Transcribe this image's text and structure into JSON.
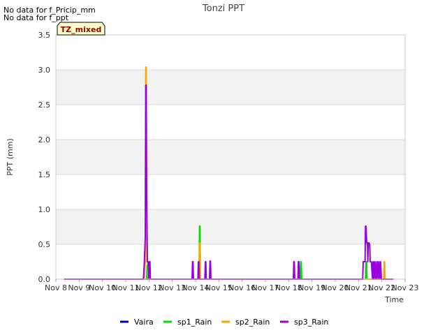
{
  "notes": [
    "No data for f_Pricip_mm",
    "No data for f_ppt"
  ],
  "badge": {
    "label": "TZ_mixed"
  },
  "chart_data": {
    "type": "line",
    "title": "Tonzi PPT",
    "xlabel": "Time",
    "ylabel": "PPT (mm)",
    "xlim": [
      8,
      23
    ],
    "ylim": [
      0,
      3.5
    ],
    "x_ticks": [
      8,
      9,
      10,
      11,
      12,
      13,
      14,
      15,
      16,
      17,
      18,
      19,
      20,
      21,
      22,
      23
    ],
    "x_tick_labels": [
      "Nov 8",
      "Nov 9",
      "Nov 10",
      "Nov 11",
      "Nov 12",
      "Nov 13",
      "Nov 14",
      "Nov 15",
      "Nov 16",
      "Nov 17",
      "Nov 18",
      "Nov 19",
      "Nov 20",
      "Nov 21",
      "Nov 22",
      "Nov 23"
    ],
    "y_ticks": [
      0.0,
      0.5,
      1.0,
      1.5,
      2.0,
      2.5,
      3.0,
      3.5
    ],
    "y_tick_labels": [
      "0.0",
      "0.5",
      "1.0",
      "1.5",
      "2.0",
      "2.5",
      "3.0",
      "3.5"
    ],
    "legend_position": "bottom",
    "grid": true,
    "series": [
      {
        "name": "Vaira",
        "color": "#0000bb",
        "x": [
          8.35,
          18.4,
          18.42,
          18.44,
          18.46,
          21.3,
          21.32,
          21.34,
          21.36,
          22.5
        ],
        "y": [
          0,
          0,
          0.25,
          0.25,
          0,
          0,
          0.25,
          0.25,
          0,
          0
        ]
      },
      {
        "name": "sp1_Rain",
        "color": "#00dd00",
        "x": [
          8.35,
          11.9,
          11.92,
          11.94,
          11.96,
          14.15,
          14.17,
          14.19,
          14.21,
          18.5,
          18.52,
          18.54,
          18.56,
          21.3,
          21.32,
          21.34,
          21.36,
          22.5
        ],
        "y": [
          0,
          0,
          0.2,
          0.2,
          0,
          0,
          0.76,
          0.76,
          0,
          0,
          0.25,
          0.25,
          0,
          0,
          0.25,
          0.25,
          0,
          0
        ]
      },
      {
        "name": "sp2_Rain",
        "color": "#ffa500",
        "x": [
          8.35,
          11.8,
          11.84,
          11.86,
          11.88,
          11.9,
          11.92,
          11.95,
          11.98,
          14.15,
          14.17,
          14.19,
          14.21,
          22.08,
          22.1,
          22.12,
          22.14,
          22.5
        ],
        "y": [
          0,
          0,
          0.25,
          3.04,
          3.04,
          0.5,
          0.25,
          0.25,
          0,
          0,
          0.52,
          0.52,
          0,
          0,
          0.25,
          0.25,
          0,
          0
        ]
      },
      {
        "name": "sp3_Rain",
        "color": "#9900dd",
        "x": [
          8.35,
          11.76,
          11.8,
          11.84,
          11.86,
          11.88,
          11.9,
          11.93,
          11.96,
          12.0,
          12.02,
          12.04,
          12.06,
          13.85,
          13.87,
          13.89,
          13.91,
          14.1,
          14.12,
          14.14,
          14.16,
          14.4,
          14.42,
          14.44,
          14.46,
          14.6,
          14.62,
          14.64,
          14.66,
          18.2,
          18.22,
          18.24,
          18.26,
          18.4,
          18.42,
          18.44,
          18.46,
          21.18,
          21.2,
          21.22,
          21.25,
          21.28,
          21.3,
          21.32,
          21.35,
          21.38,
          21.4,
          21.42,
          21.45,
          21.48,
          21.5,
          21.55,
          21.6,
          21.62,
          21.65,
          21.68,
          21.72,
          21.75,
          21.78,
          21.82,
          21.85,
          21.88,
          21.92,
          21.95,
          21.98,
          22.02,
          22.05,
          22.5
        ],
        "y": [
          0,
          0,
          0.25,
          0.6,
          2.78,
          2.78,
          1.2,
          0.25,
          0.25,
          0,
          0.25,
          0.25,
          0,
          0,
          0.25,
          0.25,
          0,
          0,
          0.25,
          0.25,
          0,
          0,
          0.25,
          0.25,
          0,
          0,
          0.26,
          0.26,
          0,
          0,
          0.25,
          0.25,
          0,
          0,
          0.25,
          0.25,
          0,
          0,
          0.25,
          0.25,
          0.25,
          0.25,
          0.76,
          0.76,
          0.52,
          0.52,
          0.25,
          0.52,
          0.52,
          0.5,
          0.25,
          0.25,
          0,
          0.25,
          0,
          0.25,
          0,
          0.25,
          0,
          0.25,
          0,
          0.25,
          0,
          0.25,
          0,
          0,
          0,
          0
        ]
      }
    ]
  }
}
